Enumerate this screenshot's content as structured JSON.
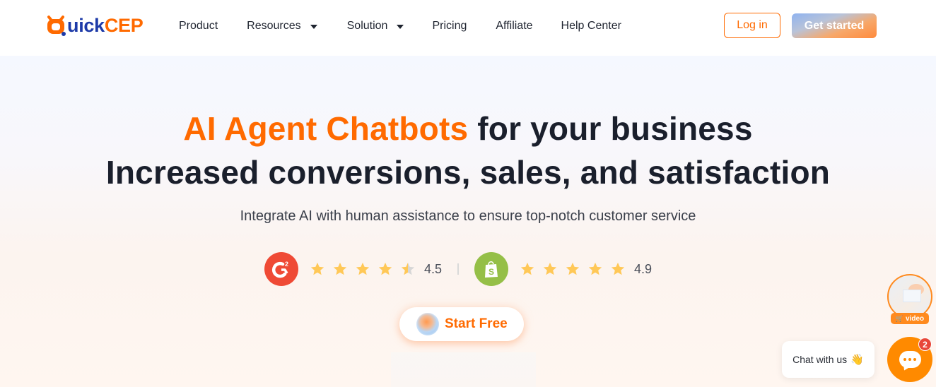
{
  "brand": {
    "name_part1": "uick",
    "name_part2": "CEP",
    "primary_color": "#ff6a00",
    "secondary_color": "#1d3aa8"
  },
  "nav": {
    "items": [
      {
        "label": "Product",
        "has_dropdown": false
      },
      {
        "label": "Resources",
        "has_dropdown": true
      },
      {
        "label": "Solution",
        "has_dropdown": true
      },
      {
        "label": "Pricing",
        "has_dropdown": false
      },
      {
        "label": "Affiliate",
        "has_dropdown": false
      },
      {
        "label": "Help Center",
        "has_dropdown": false
      }
    ],
    "login_label": "Log in",
    "get_started_label": "Get started"
  },
  "hero": {
    "headline_accent": "AI Agent Chatbots",
    "headline_rest": " for your business",
    "headline_line2": "Increased conversions, sales, and satisfaction",
    "subheadline": "Integrate AI with human assistance to ensure top-notch customer service",
    "cta_label": "Start Free"
  },
  "ratings": [
    {
      "platform": "G2",
      "icon": "g2-logo-icon",
      "score": "4.5",
      "stars": 4.5,
      "max_stars": 5,
      "color": "#ef4a35"
    },
    {
      "platform": "Shopify",
      "icon": "shopify-bag-icon",
      "score": "4.9",
      "stars": 5,
      "max_stars": 5,
      "color": "#95bf47"
    }
  ],
  "widgets": {
    "video_tag_label": "video",
    "chat_prompt": "Chat with us",
    "chat_prompt_emoji": "👋",
    "unread_count": "2",
    "launcher_color": "#ff8a00"
  }
}
